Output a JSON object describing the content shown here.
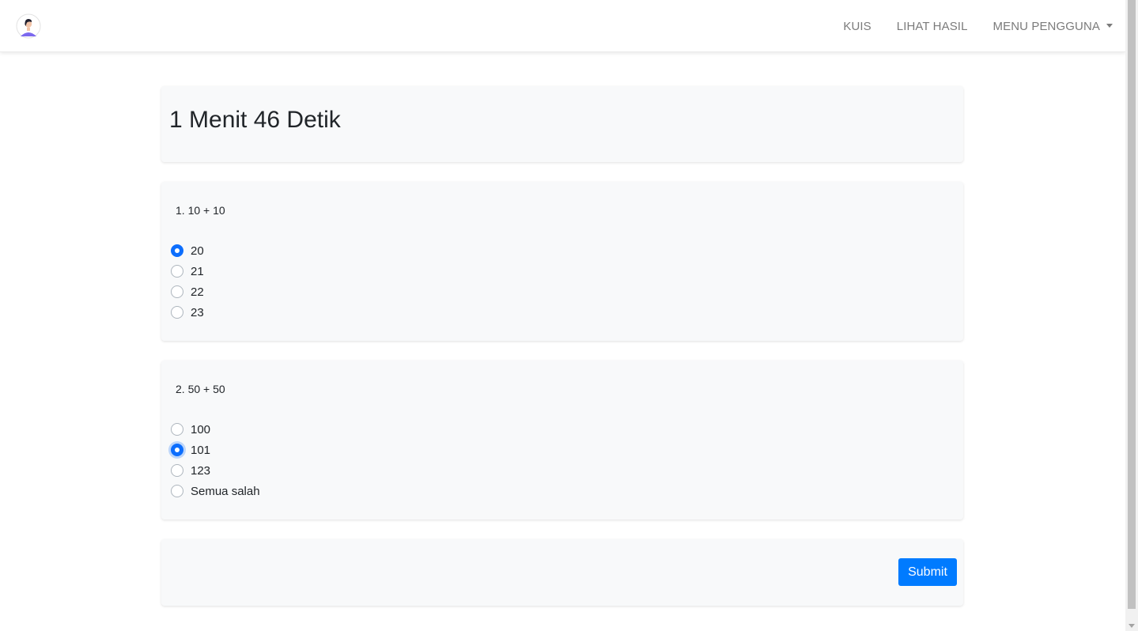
{
  "nav": {
    "links": [
      "KUIS",
      "LIHAT HASIL",
      "MENU PENGGUNA"
    ],
    "avatar_icon": "user-avatar-icon"
  },
  "timer": {
    "text": "1 Menit 46 Detik"
  },
  "questions": [
    {
      "text": "1. 10 + 10",
      "options": [
        "20",
        "21",
        "22",
        "23"
      ],
      "selected": "20"
    },
    {
      "text": "2. 50 + 50",
      "options": [
        "100",
        "101",
        "123",
        "Semua salah"
      ],
      "selected": "101"
    }
  ],
  "submit_label": "Submit",
  "colors": {
    "primary": "#007bff",
    "radio_checked": "#0d6efd",
    "card_bg": "#f8f9fa",
    "nav_text": "#7b7b7b"
  }
}
